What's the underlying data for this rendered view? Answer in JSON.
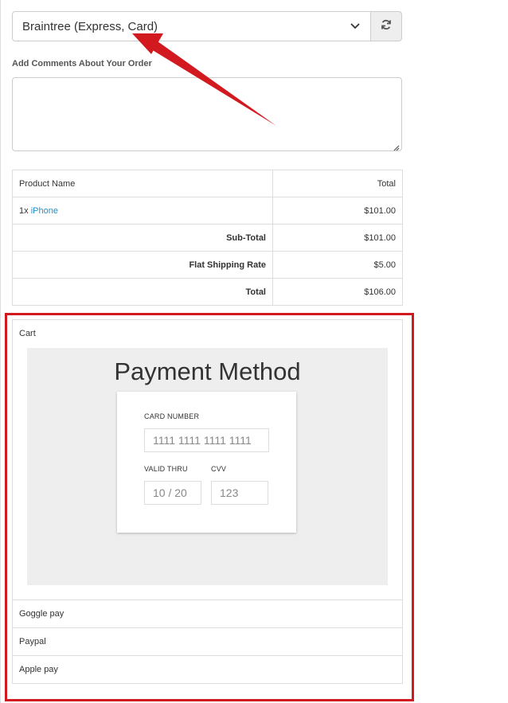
{
  "payment_select": {
    "selected": "Braintree (Express, Card)"
  },
  "comments": {
    "label": "Add Comments About Your Order",
    "value": ""
  },
  "order_table": {
    "header": {
      "product": "Product Name",
      "total": "Total"
    },
    "items": [
      {
        "qty": "1x",
        "name": "iPhone",
        "total": "$101.00"
      }
    ],
    "totals": [
      {
        "label": "Sub-Total",
        "value": "$101.00"
      },
      {
        "label": "Flat Shipping Rate",
        "value": "$5.00"
      },
      {
        "label": "Total",
        "value": "$106.00"
      }
    ]
  },
  "payment_methods": {
    "cart_label": "Cart",
    "card_form": {
      "title": "Payment Method",
      "card_number_label": "CARD NUMBER",
      "card_number_placeholder": "1111 1111 1111 1111",
      "valid_thru_label": "VALID THRU",
      "valid_thru_placeholder": "10 / 20",
      "cvv_label": "CVV",
      "cvv_placeholder": "123"
    },
    "others": [
      "Goggle pay",
      "Paypal",
      "Apple pay"
    ]
  },
  "colors": {
    "annotation_red": "#d31920",
    "link_blue": "#1e91cf",
    "card_stage_bg": "#eeeeee"
  }
}
